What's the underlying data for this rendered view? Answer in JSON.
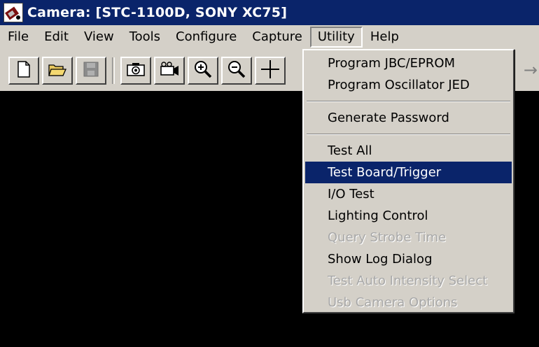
{
  "window": {
    "title": "Camera: [STC-1100D, SONY XC75]"
  },
  "menubar": {
    "items": [
      {
        "label": "File"
      },
      {
        "label": "Edit"
      },
      {
        "label": "View"
      },
      {
        "label": "Tools"
      },
      {
        "label": "Configure"
      },
      {
        "label": "Capture"
      },
      {
        "label": "Utility"
      },
      {
        "label": "Help"
      }
    ],
    "open_menu": "Utility"
  },
  "toolbar": {
    "buttons": [
      {
        "icon": "new-document-icon"
      },
      {
        "icon": "open-folder-icon"
      },
      {
        "icon": "save-disk-icon"
      },
      {
        "icon": "camera-snapshot-icon"
      },
      {
        "icon": "video-camera-icon"
      },
      {
        "icon": "zoom-in-icon"
      },
      {
        "icon": "zoom-out-icon"
      },
      {
        "icon": "crosshair-icon"
      }
    ]
  },
  "utility_menu": {
    "items": [
      {
        "label": "Program JBC/EPROM",
        "state": "normal"
      },
      {
        "label": "Program Oscillator JED",
        "state": "normal"
      },
      {
        "separator": true
      },
      {
        "label": "Generate Password",
        "state": "normal"
      },
      {
        "separator": true
      },
      {
        "label": "Test All",
        "state": "normal"
      },
      {
        "label": "Test Board/Trigger",
        "state": "selected"
      },
      {
        "label": "I/O Test",
        "state": "normal"
      },
      {
        "label": "Lighting Control",
        "state": "normal"
      },
      {
        "label": "Query Strobe Time",
        "state": "disabled"
      },
      {
        "label": "Show Log Dialog",
        "state": "normal"
      },
      {
        "label": "Test Auto Intensity Select",
        "state": "disabled"
      },
      {
        "label": "Usb Camera Options",
        "state": "disabled"
      }
    ]
  },
  "colors": {
    "titlebar": "#0a246a",
    "highlight": "#0a246a",
    "face": "#d4d0c8",
    "canvas": "#000000",
    "disabled_text": "#a8a8a8"
  }
}
